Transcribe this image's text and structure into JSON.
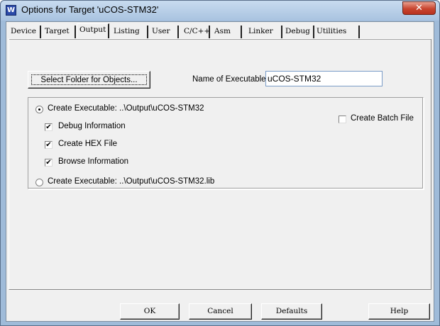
{
  "window": {
    "title": "Options for Target 'uCOS-STM32'",
    "app_icon": "W",
    "close_glyph": "✕"
  },
  "tabs": [
    {
      "label": "Device"
    },
    {
      "label": "Target"
    },
    {
      "label": "Output"
    },
    {
      "label": "Listing"
    },
    {
      "label": "User"
    },
    {
      "label": "C/C++"
    },
    {
      "label": "Asm"
    },
    {
      "label": "Linker"
    },
    {
      "label": "Debug"
    },
    {
      "label": "Utilities"
    }
  ],
  "active_tab": "Output",
  "output": {
    "select_folder_label": "Select Folder for Objects...",
    "name_exec_label": "Name of Executable:",
    "name_exec_value": "uCOS-STM32",
    "create_exec_label": "Create Executable:  ..\\Output\\uCOS-STM32",
    "create_exec_selected": true,
    "debug_info_label": "Debug Information",
    "debug_info_checked": true,
    "create_hex_label": "Create HEX File",
    "create_hex_checked": true,
    "browse_info_label": "Browse Information",
    "browse_info_checked": true,
    "create_lib_label": "Create Executable:  ..\\Output\\uCOS-STM32.lib",
    "create_lib_selected": false,
    "create_batch_label": "Create Batch File",
    "create_batch_checked": false,
    "check_glyph": "✔"
  },
  "buttons": {
    "ok": "OK",
    "cancel": "Cancel",
    "defaults": "Defaults",
    "help": "Help"
  }
}
